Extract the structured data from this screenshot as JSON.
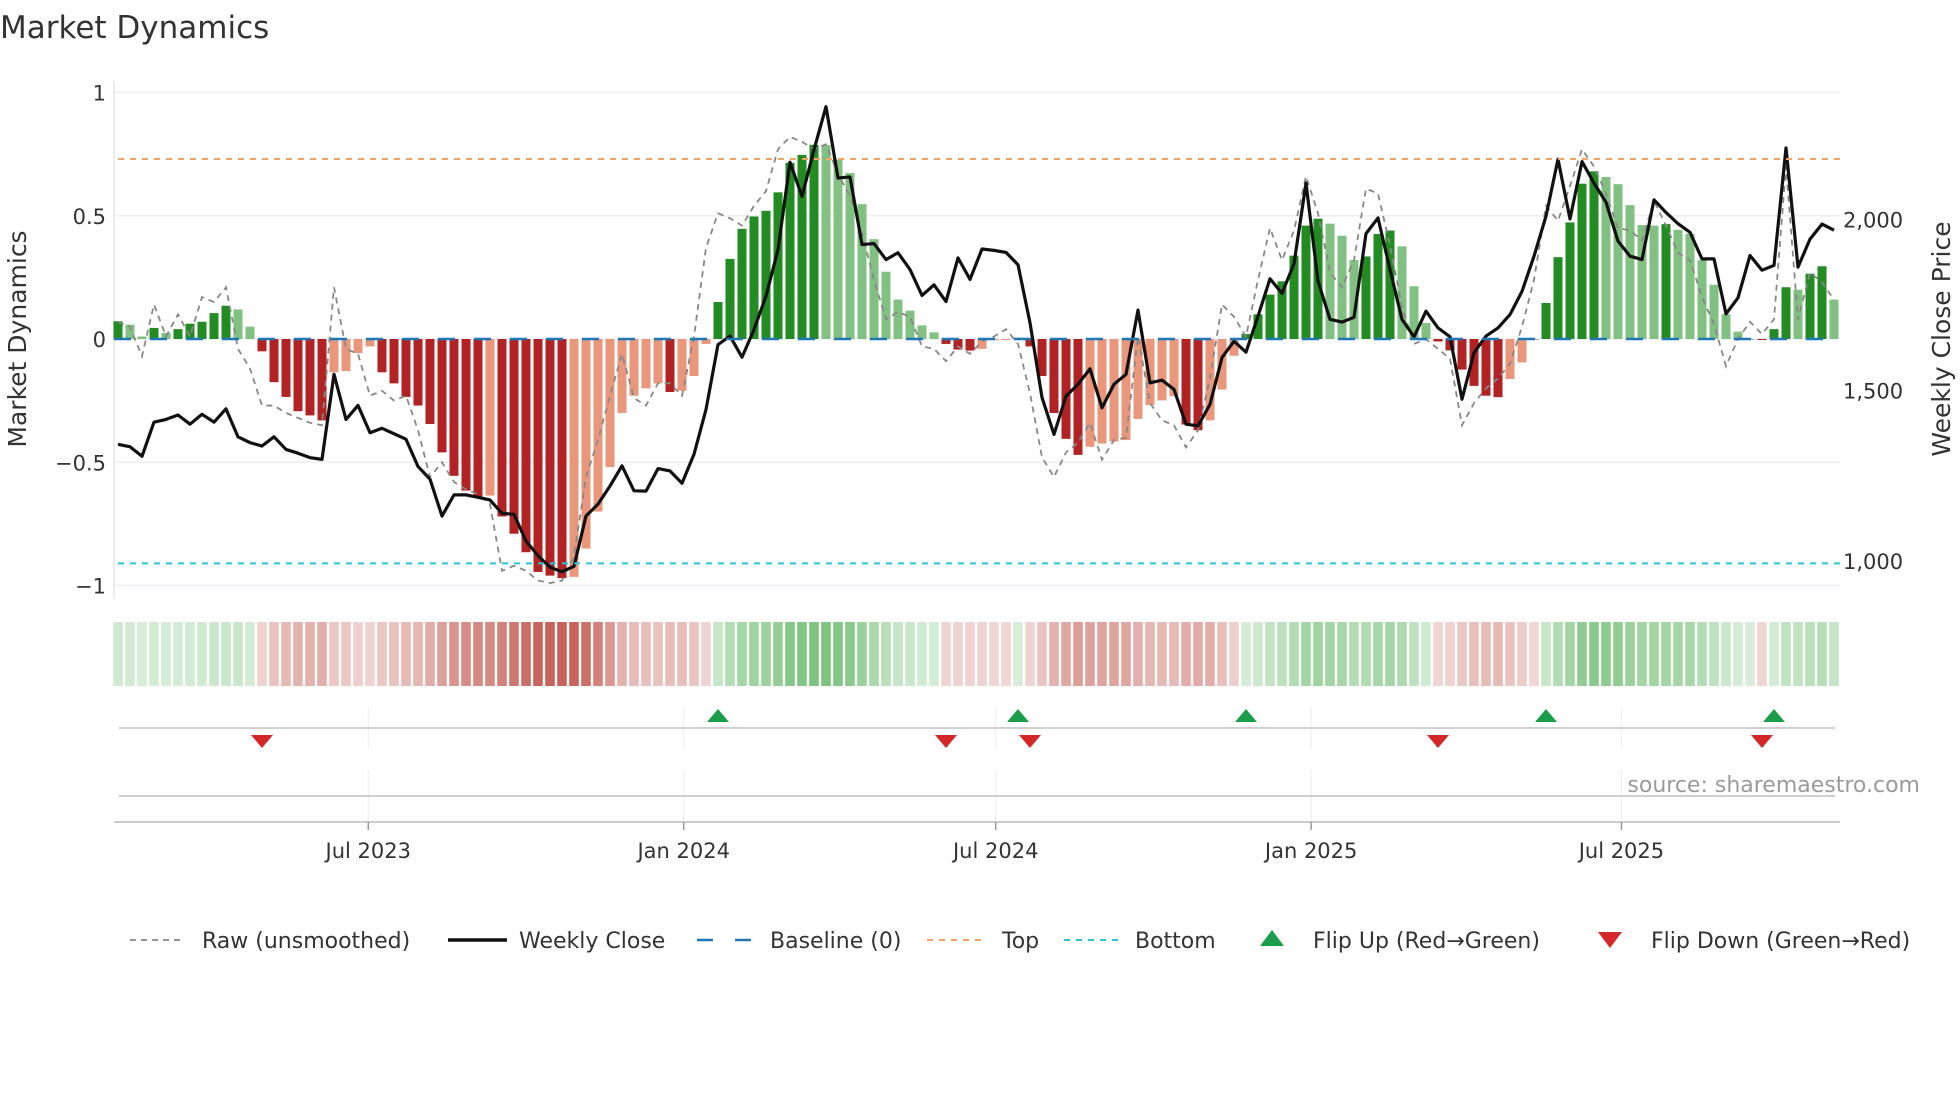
{
  "chart_data": {
    "type": "bar",
    "title": "Market Dynamics",
    "ylabel": "Market Dynamics",
    "ylabel_right": "Weekly Close Price",
    "ylim": [
      -1.05,
      1.05
    ],
    "ylim_right": [
      892,
      2406
    ],
    "yticks": [
      {
        "v": 1,
        "label": "1"
      },
      {
        "v": 0.5,
        "label": "0.5"
      },
      {
        "v": 0,
        "label": "0"
      },
      {
        "v": -0.5,
        "label": "−0.5"
      },
      {
        "v": -1,
        "label": "−1"
      }
    ],
    "yticks_right": [
      {
        "v": 2000,
        "label": "2,000"
      },
      {
        "v": 1500,
        "label": "1,500"
      },
      {
        "v": 1000,
        "label": "1,000"
      }
    ],
    "x_start_date": "2023-02-05",
    "x_step_days": 7,
    "xticks": [
      {
        "date": "2023-07-01",
        "label": "Jul 2023"
      },
      {
        "date": "2024-01-01",
        "label": "Jan 2024"
      },
      {
        "date": "2024-07-01",
        "label": "Jul 2024"
      },
      {
        "date": "2025-01-01",
        "label": "Jan 2025"
      },
      {
        "date": "2025-07-01",
        "label": "Jul 2025"
      }
    ],
    "grid": true,
    "top_level": 0.73,
    "bottom_level": -0.91,
    "baseline": 0,
    "series": [
      {
        "name": "Market Dynamics (smoothed)",
        "type": "bar",
        "values": [
          0.072,
          0.058,
          0.01,
          0.045,
          0.025,
          0.04,
          0.062,
          0.07,
          0.105,
          0.135,
          0.12,
          0.05,
          -0.05,
          -0.175,
          -0.235,
          -0.293,
          -0.31,
          -0.33,
          -0.135,
          -0.13,
          -0.057,
          -0.03,
          -0.135,
          -0.18,
          -0.235,
          -0.27,
          -0.345,
          -0.46,
          -0.555,
          -0.615,
          -0.64,
          -0.635,
          -0.72,
          -0.79,
          -0.865,
          -0.945,
          -0.96,
          -0.97,
          -0.965,
          -0.85,
          -0.7,
          -0.52,
          -0.3,
          -0.23,
          -0.2,
          -0.18,
          -0.215,
          -0.21,
          -0.15,
          -0.02,
          0.15,
          0.325,
          0.447,
          0.497,
          0.52,
          0.595,
          0.715,
          0.747,
          0.788,
          0.787,
          0.727,
          0.673,
          0.547,
          0.405,
          0.273,
          0.16,
          0.115,
          0.055,
          0.027,
          -0.02,
          -0.043,
          -0.047,
          -0.04,
          -0.005,
          -0.002,
          0.005,
          -0.03,
          -0.15,
          -0.3,
          -0.405,
          -0.47,
          -0.437,
          -0.424,
          -0.416,
          -0.41,
          -0.324,
          -0.268,
          -0.249,
          -0.232,
          -0.347,
          -0.37,
          -0.33,
          -0.205,
          -0.068,
          0.02,
          0.1,
          0.18,
          0.234,
          0.338,
          0.46,
          0.488,
          0.468,
          0.419,
          0.32,
          0.335,
          0.426,
          0.44,
          0.376,
          0.214,
          0.065,
          -0.01,
          -0.046,
          -0.124,
          -0.19,
          -0.23,
          -0.236,
          -0.162,
          -0.095,
          -0.002,
          0.146,
          0.332,
          0.473,
          0.63,
          0.68,
          0.657,
          0.628,
          0.543,
          0.462,
          0.46,
          0.466,
          0.443,
          0.427,
          0.32,
          0.22,
          0.1,
          0.03,
          0.001,
          -0.004,
          0.04,
          0.21,
          0.2,
          0.265,
          0.295,
          0.16
        ]
      },
      {
        "name": "Raw (unsmoothed)",
        "type": "line",
        "values": [
          0.07,
          0.05,
          -0.07,
          0.14,
          0.01,
          0.1,
          0.01,
          0.17,
          0.15,
          0.21,
          -0.04,
          -0.12,
          -0.27,
          -0.27,
          -0.3,
          -0.32,
          -0.34,
          -0.35,
          0.21,
          -0.04,
          -0.06,
          -0.23,
          -0.21,
          -0.25,
          -0.23,
          -0.37,
          -0.56,
          -0.5,
          -0.58,
          -0.61,
          -0.63,
          -0.67,
          -0.94,
          -0.92,
          -0.94,
          -0.98,
          -0.99,
          -0.98,
          -0.88,
          -0.56,
          -0.41,
          -0.23,
          -0.06,
          -0.24,
          -0.27,
          -0.18,
          -0.18,
          -0.23,
          0.01,
          0.37,
          0.51,
          0.49,
          0.46,
          0.54,
          0.6,
          0.77,
          0.82,
          0.8,
          0.77,
          0.79,
          0.67,
          0.58,
          0.43,
          0.24,
          0.08,
          0.11,
          0.09,
          -0.03,
          -0.04,
          -0.09,
          -0.03,
          -0.06,
          -0.01,
          0.01,
          0.04,
          -0.02,
          -0.22,
          -0.48,
          -0.56,
          -0.46,
          -0.42,
          -0.34,
          -0.49,
          -0.41,
          -0.4,
          0.01,
          -0.26,
          -0.33,
          -0.35,
          -0.44,
          -0.37,
          -0.16,
          0.14,
          0.09,
          0.01,
          0.24,
          0.45,
          0.32,
          0.44,
          0.66,
          0.51,
          0.27,
          0.21,
          0.32,
          0.61,
          0.59,
          0.38,
          0.13,
          -0.02,
          0.0,
          -0.04,
          -0.08,
          -0.35,
          -0.26,
          -0.2,
          -0.16,
          -0.1,
          0.05,
          0.24,
          0.54,
          0.48,
          0.62,
          0.77,
          0.7,
          0.59,
          0.45,
          0.44,
          0.4,
          0.56,
          0.46,
          0.35,
          0.32,
          0.17,
          0.06,
          -0.11,
          0.0,
          0.07,
          0.02,
          0.08,
          0.7,
          0.08,
          0.27,
          0.23,
          0.16
        ]
      },
      {
        "name": "Weekly Close",
        "type": "line",
        "axis": "right",
        "values": [
          1342,
          1335,
          1307,
          1407,
          1415,
          1428,
          1401,
          1430,
          1407,
          1446,
          1364,
          1347,
          1337,
          1364,
          1327,
          1316,
          1303,
          1298,
          1547,
          1415,
          1456,
          1376,
          1389,
          1373,
          1357,
          1277,
          1240,
          1132,
          1194,
          1194,
          1187,
          1179,
          1140,
          1137,
          1059,
          1016,
          982,
          969,
          985,
          1132,
          1167,
          1220,
          1279,
          1206,
          1205,
          1271,
          1264,
          1228,
          1313,
          1444,
          1634,
          1659,
          1597,
          1678,
          1776,
          1912,
          2168,
          2068,
          2205,
          2331,
          2122,
          2125,
          1927,
          1930,
          1883,
          1903,
          1854,
          1778,
          1809,
          1760,
          1888,
          1825,
          1914,
          1910,
          1904,
          1868,
          1698,
          1479,
          1371,
          1483,
          1518,
          1563,
          1449,
          1518,
          1547,
          1735,
          1522,
          1530,
          1503,
          1401,
          1396,
          1459,
          1596,
          1644,
          1612,
          1717,
          1827,
          1784,
          1871,
          2107,
          1820,
          1708,
          1700,
          1714,
          1959,
          2005,
          1854,
          1708,
          1657,
          1732,
          1683,
          1657,
          1474,
          1610,
          1659,
          1683,
          1722,
          1790,
          1893,
          2010,
          2177,
          2002,
          2170,
          2107,
          2051,
          1937,
          1893,
          1883,
          2058,
          2021,
          1988,
          1963,
          1885,
          1885,
          1724,
          1771,
          1895,
          1852,
          1866,
          2210,
          1861,
          1943,
          1987,
          1969
        ]
      }
    ],
    "flip_up_index": [
      50,
      75,
      94,
      119,
      138
    ],
    "flip_down_index": [
      12,
      69,
      76,
      110,
      137
    ],
    "legend": {
      "placement": "bottom",
      "items": [
        {
          "label": "Raw (unsmoothed)",
          "kind": "raw"
        },
        {
          "label": "Weekly Close",
          "kind": "close"
        },
        {
          "label": "Baseline (0)",
          "kind": "baseline"
        },
        {
          "label": "Top",
          "kind": "top"
        },
        {
          "label": "Bottom",
          "kind": "bottom"
        },
        {
          "label": "Flip Up (Red→Green)",
          "kind": "up"
        },
        {
          "label": "Flip Down (Green→Red)",
          "kind": "down"
        }
      ]
    },
    "source": "source: sharemaestro.com",
    "colors": {
      "pos_strong": "#228b22",
      "pos_weak": "#80c080",
      "neg_strong": "#b22222",
      "neg_weak": "#e9967a",
      "raw": "#888888",
      "close": "#111111",
      "baseline": "#1f77b4",
      "top": "#f4a460",
      "bottom": "#26c6da",
      "flip_up": "#1a9e4a",
      "flip_down": "#d62728",
      "strip_pos": "#4caf50",
      "strip_neg": "#be463c"
    }
  }
}
